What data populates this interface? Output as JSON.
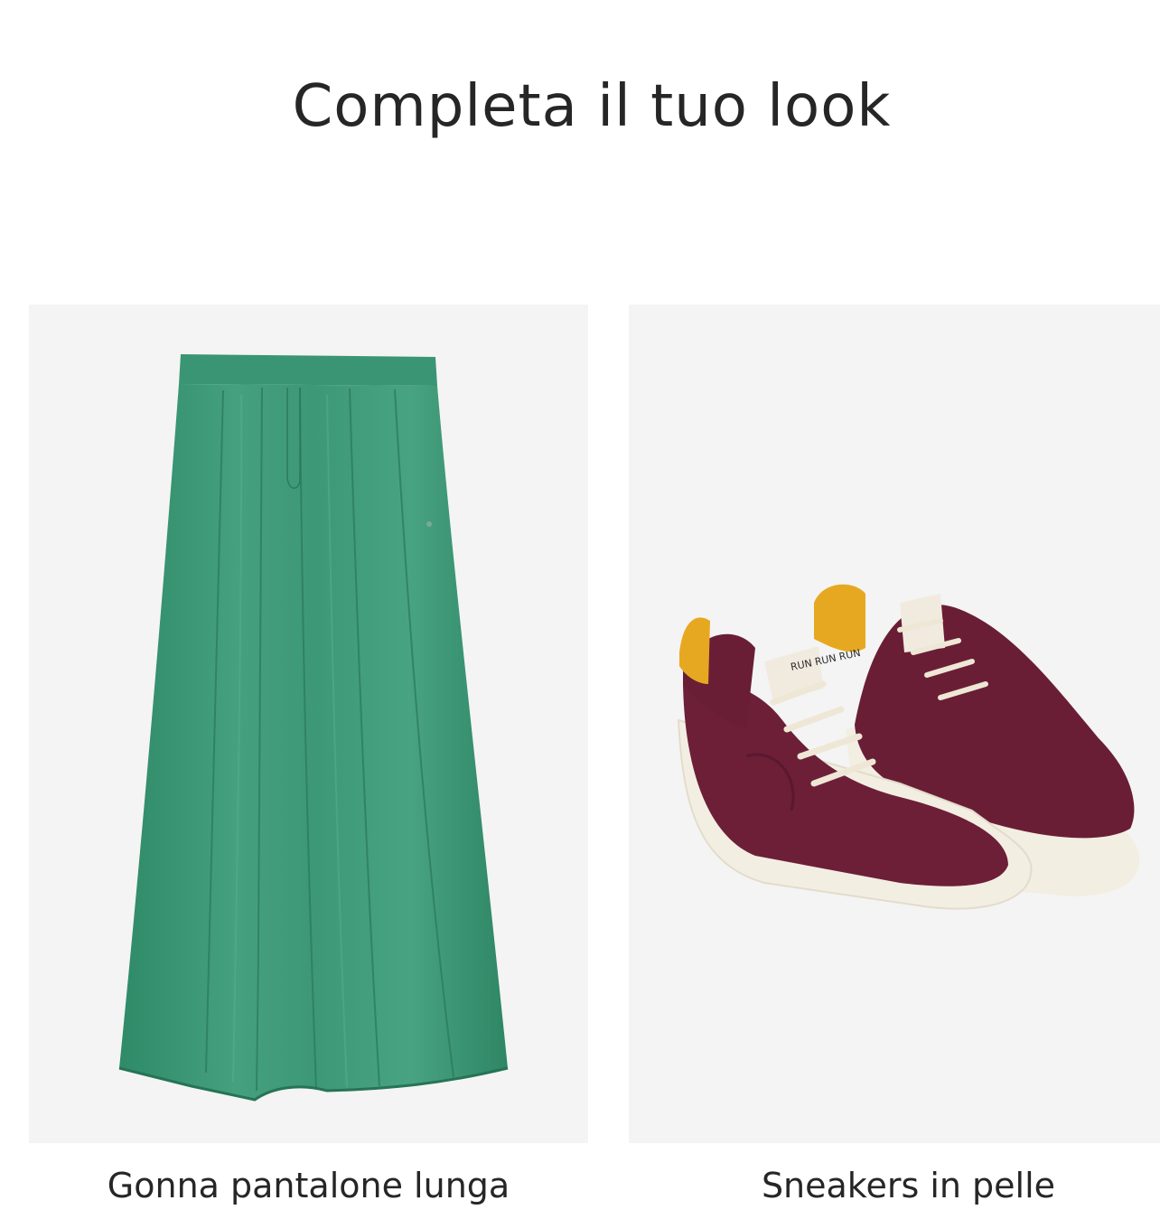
{
  "section": {
    "title": "Completa il tuo look"
  },
  "products": [
    {
      "name": "Gonna pantalone lunga",
      "image": "green-pleated-palazzo-trousers",
      "color": "#3f9a78"
    },
    {
      "name": "Sneakers in pelle",
      "image": "burgundy-suede-sneakers",
      "color": "#6d1f38"
    }
  ],
  "sneaker_tongue_label": "RUN RUN RUN"
}
